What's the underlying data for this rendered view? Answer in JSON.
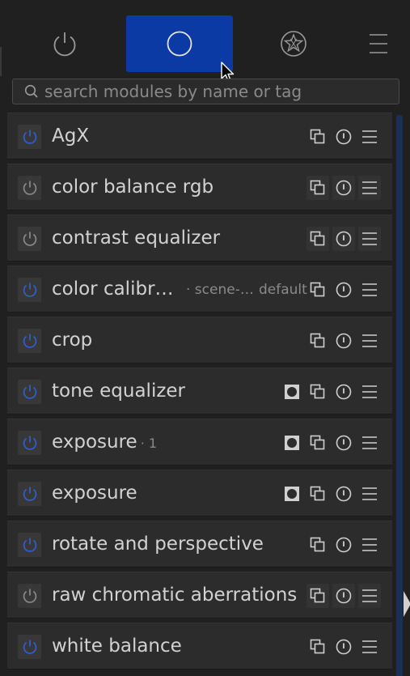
{
  "tabs": [
    {
      "name": "power-icon",
      "active": false
    },
    {
      "name": "circle-icon",
      "active": true
    },
    {
      "name": "favorites-star-icon",
      "active": false
    },
    {
      "name": "hamburger-menu-icon",
      "active": false
    }
  ],
  "search": {
    "placeholder": "search modules by name or tag"
  },
  "colors": {
    "active_tab": "#0b3aa5",
    "power_on": "#2f5fd0",
    "power_off": "#8a8a8a",
    "scrollbar": "#1b2f57"
  },
  "modules": [
    {
      "name": "AgX",
      "instance": "",
      "label": "",
      "preset": "",
      "enabled": true,
      "has_mask": false
    },
    {
      "name": "color balance rgb",
      "instance": "",
      "label": "",
      "preset": "",
      "enabled": false,
      "has_mask": false
    },
    {
      "name": "contrast equalizer",
      "instance": "",
      "label": "",
      "preset": "",
      "enabled": false,
      "has_mask": false
    },
    {
      "name": "color calibr…",
      "instance": "",
      "label": "· scene-…",
      "preset": "default",
      "enabled": true,
      "has_mask": false
    },
    {
      "name": "crop",
      "instance": "",
      "label": "",
      "preset": "",
      "enabled": true,
      "has_mask": false
    },
    {
      "name": "tone equalizer",
      "instance": "",
      "label": "",
      "preset": "",
      "enabled": true,
      "has_mask": true
    },
    {
      "name": "exposure",
      "instance": "· 1",
      "label": "",
      "preset": "",
      "enabled": true,
      "has_mask": true
    },
    {
      "name": "exposure",
      "instance": "",
      "label": "",
      "preset": "",
      "enabled": true,
      "has_mask": true
    },
    {
      "name": "rotate and perspective",
      "instance": "",
      "label": "",
      "preset": "",
      "enabled": true,
      "has_mask": false
    },
    {
      "name": "raw chromatic aberrations",
      "instance": "",
      "label": "",
      "preset": "",
      "enabled": false,
      "has_mask": false
    },
    {
      "name": "white balance",
      "instance": "",
      "label": "",
      "preset": "",
      "enabled": true,
      "has_mask": false
    }
  ]
}
